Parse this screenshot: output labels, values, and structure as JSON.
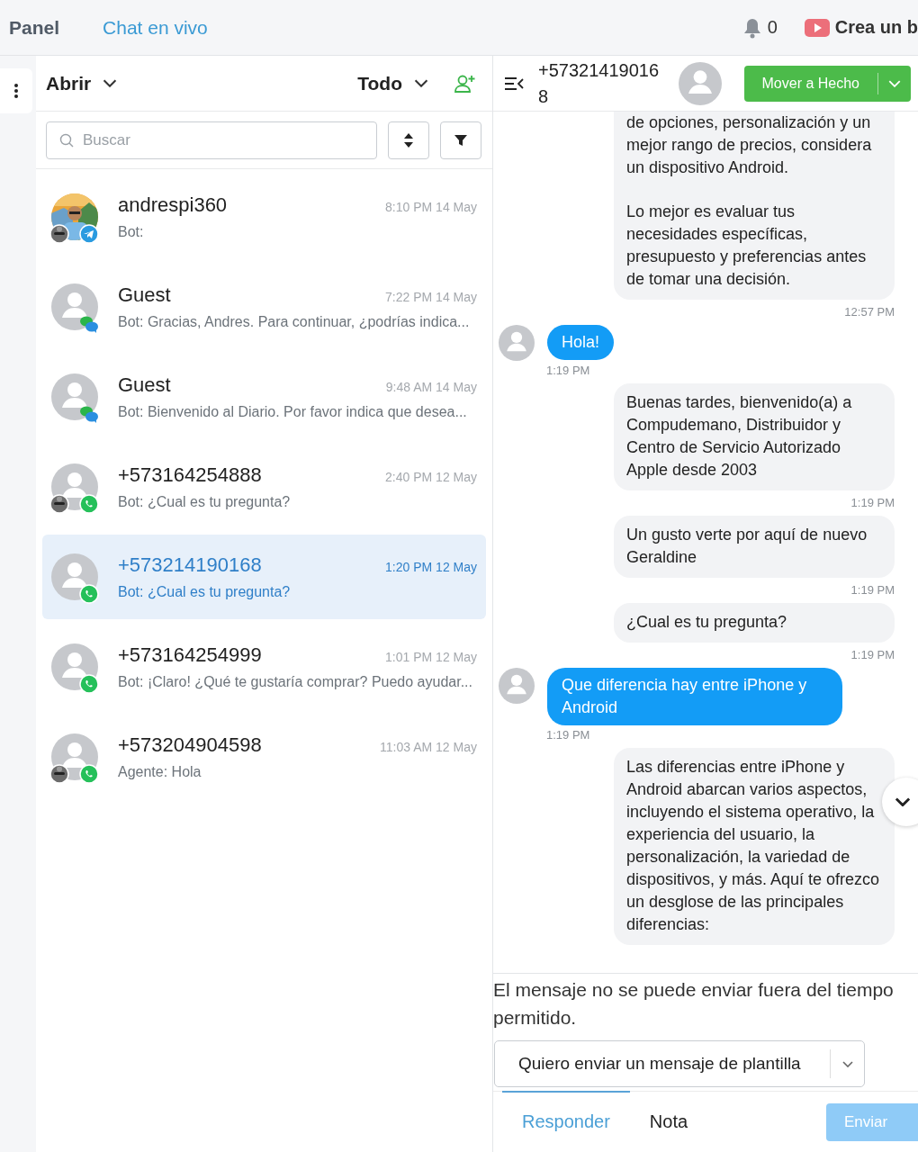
{
  "top_nav": {
    "items": [
      {
        "label": "Panel",
        "selected": false
      },
      {
        "label": "Chat en vivo",
        "selected": true
      }
    ],
    "notifications": "0",
    "promo": "Crea un b"
  },
  "inbox": {
    "status_filter": "Abrir",
    "scope_filter": "Todo",
    "search": {
      "placeholder": "Buscar"
    }
  },
  "conversations": [
    {
      "name": "andrespi360",
      "time": "8:10 PM 14 May",
      "preview": "Bot:",
      "selected": false,
      "channel": {
        "kind": "telegram"
      },
      "assigned": true
    },
    {
      "name": "Guest",
      "time": "7:22 PM 14 May",
      "preview": "Bot: Gracias, Andres. Para continuar, ¿podrías indica...",
      "selected": false,
      "avatar": {
        "kind": "placeholder"
      },
      "channel": {
        "kind": "webchat"
      },
      "assigned": false
    },
    {
      "name": "Guest",
      "time": "9:48 AM 14 May",
      "preview": "Bot: Bienvenido al Diario. Por favor indica que desea...",
      "selected": false,
      "avatar": {
        "kind": "placeholder"
      },
      "channel": {
        "kind": "webchat"
      },
      "assigned": false
    },
    {
      "name": "+573164254888",
      "time": "2:40 PM 12 May",
      "preview": "Bot: ¿Cual es tu pregunta?",
      "selected": false,
      "avatar": {
        "kind": "placeholder"
      },
      "channel": {
        "kind": "whatsapp"
      },
      "assigned": true
    },
    {
      "name": "+573214190168",
      "time": "1:20 PM 12 May",
      "preview": "Bot: ¿Cual es tu pregunta?",
      "selected": true,
      "avatar": {
        "kind": "placeholder"
      },
      "channel": {
        "kind": "whatsapp"
      },
      "assigned": false
    },
    {
      "name": "+573164254999",
      "time": "1:01 PM 12 May",
      "preview": "Bot: ¡Claro! ¿Qué te gustaría comprar? Puedo ayudar...",
      "selected": false,
      "avatar": {
        "kind": "placeholder"
      },
      "channel": {
        "kind": "whatsapp"
      },
      "assigned": false
    },
    {
      "name": "+573204904598",
      "time": "11:03 AM 12 May",
      "preview": "Agente: Hola",
      "selected": false,
      "avatar": {
        "kind": "placeholder"
      },
      "channel": {
        "kind": "whatsapp"
      },
      "assigned": true
    }
  ],
  "chat": {
    "contact": "+573214190168",
    "resolve_button": "Mover a Hecho",
    "messages": [
      {
        "kind": "outgoing",
        "paragraphs": [
          "de opciones, personalización y un mejor rango de precios, considera un dispositivo Android.",
          "Lo mejor es evaluar tus necesidades específicas, presupuesto y preferencias antes de tomar una decisión."
        ],
        "time": "12:57 PM"
      },
      {
        "kind": "incoming",
        "paragraphs": [
          "Hola!"
        ],
        "time": "1:19 PM"
      },
      {
        "kind": "outgoing",
        "paragraphs": [
          "Buenas tardes, bienvenido(a) a Compudemano, Distribuidor y Centro de Servicio Autorizado Apple desde 2003"
        ],
        "time": "1:19 PM"
      },
      {
        "kind": "outgoing",
        "paragraphs": [
          "Un gusto verte por aquí de nuevo Geraldine"
        ],
        "time": "1:19 PM"
      },
      {
        "kind": "outgoing",
        "paragraphs": [
          "¿Cual es tu pregunta?"
        ],
        "time": "1:19 PM"
      },
      {
        "kind": "incoming",
        "paragraphs": [
          "Que diferencia hay entre iPhone y Android"
        ],
        "time": "1:19 PM"
      },
      {
        "kind": "outgoing",
        "paragraphs": [
          "Las diferencias entre iPhone y Android abarcan varios aspectos, incluyendo el sistema operativo, la experiencia del usuario, la personalización, la variedad de dispositivos, y más. Aquí te ofrezco un desglose de las principales diferencias:"
        ]
      }
    ],
    "warning": "El mensaje no se puede enviar fuera del tiempo permitido.",
    "template_select": "Quiero enviar un mensaje de plantilla",
    "reply_tabs": [
      {
        "label": "Responder",
        "selected": true
      },
      {
        "label": "Nota",
        "selected": false
      }
    ],
    "send_button": {
      "label": "Enviar",
      "disabled": true
    }
  }
}
